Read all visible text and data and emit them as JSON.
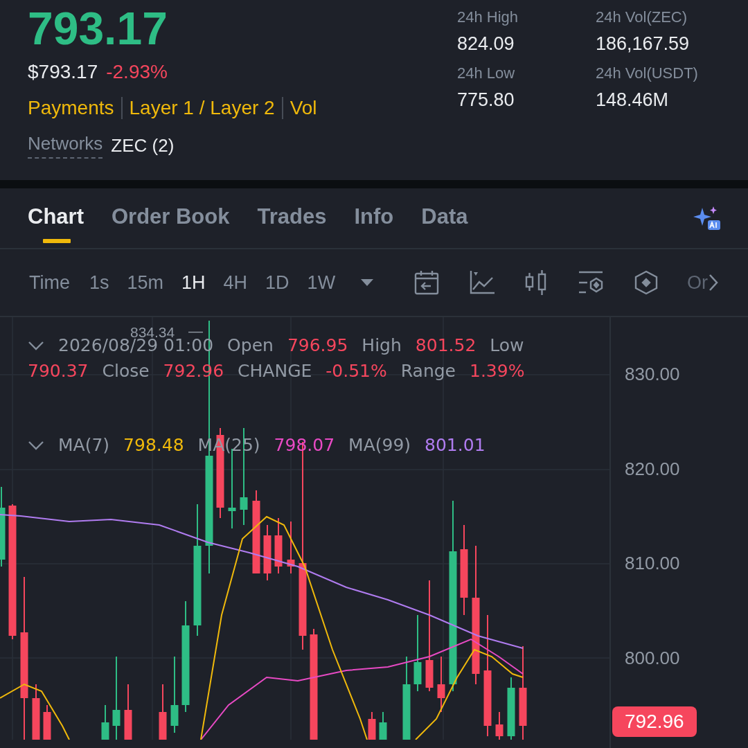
{
  "ticker": {
    "last_price": "793.17",
    "fiat_price": "$793.17",
    "change": "-2.93%",
    "tags": [
      "Payments",
      "Layer 1 / Layer 2",
      "Vol"
    ],
    "networks_label": "Networks",
    "networks_value": "ZEC (2)"
  },
  "stats": [
    {
      "label": "24h High",
      "value": "824.09"
    },
    {
      "label": "24h Vol(ZEC)",
      "value": "186,167.59"
    },
    {
      "label": "24h Low",
      "value": "775.80"
    },
    {
      "label": "24h Vol(USDT)",
      "value": "148.46M"
    }
  ],
  "tabs": [
    {
      "label": "Chart",
      "selected": true
    },
    {
      "label": "Order Book",
      "selected": false
    },
    {
      "label": "Trades",
      "selected": false
    },
    {
      "label": "Info",
      "selected": false
    },
    {
      "label": "Data",
      "selected": false
    }
  ],
  "intervals": [
    {
      "label": "Time",
      "selected": false
    },
    {
      "label": "1s",
      "selected": false
    },
    {
      "label": "15m",
      "selected": false
    },
    {
      "label": "1H",
      "selected": true
    },
    {
      "label": "4H",
      "selected": false
    },
    {
      "label": "1D",
      "selected": false
    },
    {
      "label": "1W",
      "selected": false
    }
  ],
  "toolbar_more": "Or",
  "chart": {
    "high_marker": "834.34",
    "legend": [
      {
        "kind": "label",
        "text": "2026/08/29 01:00"
      },
      {
        "kind": "label",
        "text": "Open"
      },
      {
        "kind": "value",
        "text": "796.95"
      },
      {
        "kind": "label",
        "text": "High"
      },
      {
        "kind": "value",
        "text": "801.52"
      },
      {
        "kind": "label",
        "text": "Low"
      },
      {
        "kind": "value",
        "text": "790.37"
      },
      {
        "kind": "label",
        "text": "Close"
      },
      {
        "kind": "value",
        "text": "792.96"
      },
      {
        "kind": "label",
        "text": "CHANGE"
      },
      {
        "kind": "value",
        "text": "-0.51%"
      },
      {
        "kind": "label",
        "text": "Range"
      },
      {
        "kind": "value",
        "text": "1.39%"
      }
    ],
    "moving_averages": [
      {
        "label": "MA(7)",
        "value": "798.48",
        "color": "#f0b90b"
      },
      {
        "label": "MA(25)",
        "value": "798.07",
        "color": "#e84ac4"
      },
      {
        "label": "MA(99)",
        "value": "801.01",
        "color": "#b07cf0"
      }
    ],
    "high_marker_line": "—",
    "price_axis": [
      "830.00",
      "820.00",
      "810.00",
      "800.00"
    ],
    "current_price": "792.96"
  }
}
